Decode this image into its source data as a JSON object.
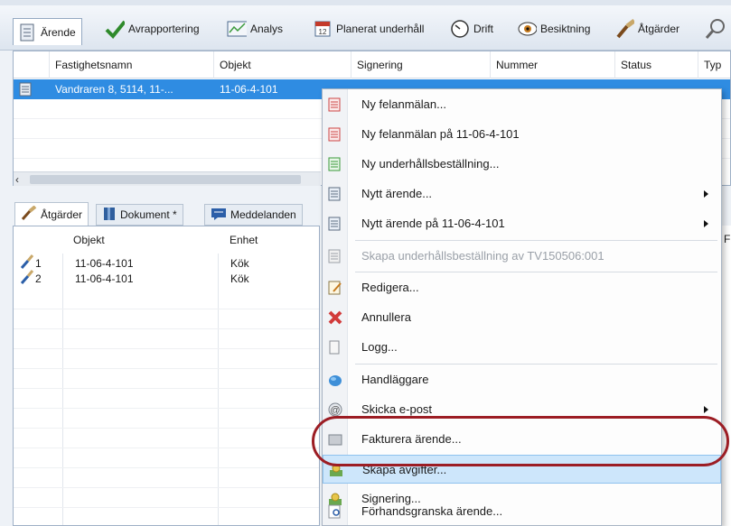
{
  "toolbar": {
    "items": [
      {
        "label": "Ärende",
        "icon": "document-icon"
      },
      {
        "label": "Avrapportering",
        "icon": "checkmark-icon"
      },
      {
        "label": "Analys",
        "icon": "chart-icon"
      },
      {
        "label": "Planerat underhåll",
        "icon": "calendar-icon"
      },
      {
        "label": "Drift",
        "icon": "gauge-icon"
      },
      {
        "label": "Besiktning",
        "icon": "eye-icon"
      },
      {
        "label": "Åtgärder",
        "icon": "brush-icon"
      }
    ]
  },
  "main_grid": {
    "columns": [
      "Fastighetsnamn",
      "Objekt",
      "Signering",
      "Nummer",
      "Status",
      "Typ"
    ],
    "selected_row": {
      "fastighetsnamn": "Vandraren 8,  5114, 11-...",
      "objekt": "11-06-4-101"
    }
  },
  "lower_tabs": [
    {
      "label": "Åtgärder",
      "icon": "brush-icon"
    },
    {
      "label": "Dokument *",
      "icon": "book-icon"
    },
    {
      "label": "Meddelanden",
      "icon": "message-icon"
    }
  ],
  "lower_grid": {
    "columns": [
      "Objekt",
      "Enhet"
    ],
    "right_header": "F",
    "rows": [
      {
        "num": "1",
        "objekt": "11-06-4-101",
        "enhet": "Kök"
      },
      {
        "num": "2",
        "objekt": "11-06-4-101",
        "enhet": "Kök"
      }
    ]
  },
  "context_menu": {
    "items": [
      {
        "label": "Ny felanmälan...",
        "icon": "form-red-icon"
      },
      {
        "label": "Ny felanmälan på 11-06-4-101",
        "icon": "form-red-icon"
      },
      {
        "label": "Ny underhållsbeställning...",
        "icon": "form-green-icon"
      },
      {
        "label": "Nytt ärende...",
        "icon": "form-blue-icon"
      },
      {
        "label": "Nytt ärende på 11-06-4-101",
        "icon": "form-blue-icon"
      },
      {
        "label": "Skapa underhållsbeställning av TV150506:001",
        "icon": "form-grey-icon"
      },
      {
        "label": "Redigera...",
        "icon": "edit-icon"
      },
      {
        "label": "Annullera",
        "icon": "cancel-x-icon"
      },
      {
        "label": "Logg...",
        "icon": "log-icon"
      },
      {
        "label": "Handläggare",
        "icon": "user-blob-icon"
      },
      {
        "label": "Skicka e-post",
        "icon": "at-icon"
      },
      {
        "label": "Fakturera ärende...",
        "icon": "invoice-icon"
      },
      {
        "label": "Skapa avgifter...",
        "icon": "fees-icon"
      },
      {
        "label": "Signering...",
        "icon": "sign-icon"
      },
      {
        "label": "Förhandsgranska ärende...",
        "icon": "preview-icon"
      }
    ]
  }
}
